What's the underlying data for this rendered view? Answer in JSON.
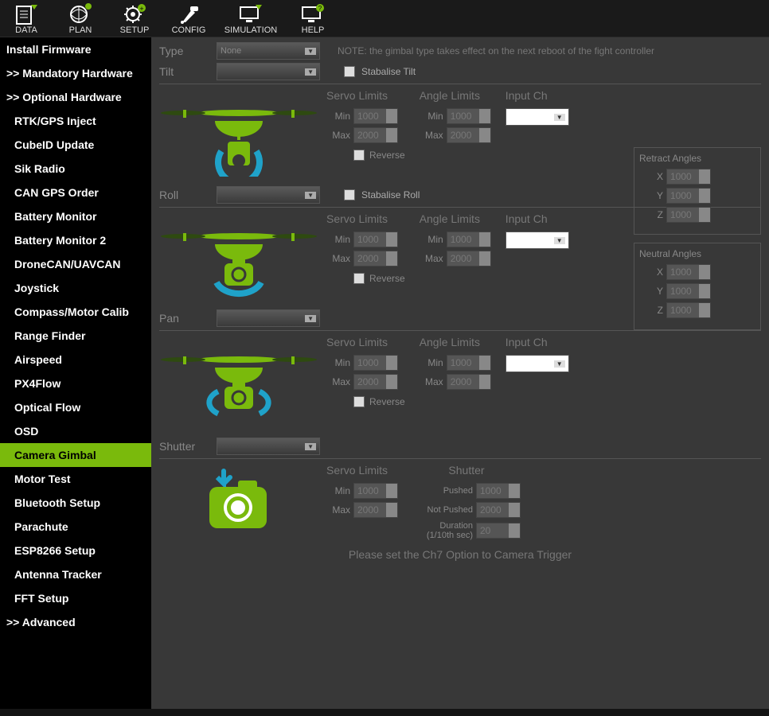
{
  "toolbar": [
    {
      "id": "data",
      "label": "DATA"
    },
    {
      "id": "plan",
      "label": "PLAN"
    },
    {
      "id": "setup",
      "label": "SETUP"
    },
    {
      "id": "config",
      "label": "CONFIG"
    },
    {
      "id": "simulation",
      "label": "SIMULATION"
    },
    {
      "id": "help",
      "label": "HELP"
    }
  ],
  "sidebar": {
    "items": [
      {
        "label": "Install Firmware",
        "sub": false
      },
      {
        "label": ">> Mandatory Hardware",
        "sub": false
      },
      {
        "label": ">> Optional Hardware",
        "sub": false
      },
      {
        "label": "RTK/GPS Inject",
        "sub": true
      },
      {
        "label": "CubeID Update",
        "sub": true
      },
      {
        "label": "Sik Radio",
        "sub": true
      },
      {
        "label": "CAN GPS Order",
        "sub": true
      },
      {
        "label": "Battery Monitor",
        "sub": true
      },
      {
        "label": "Battery Monitor 2",
        "sub": true
      },
      {
        "label": "DroneCAN/UAVCAN",
        "sub": true
      },
      {
        "label": "Joystick",
        "sub": true
      },
      {
        "label": "Compass/Motor Calib",
        "sub": true
      },
      {
        "label": "Range Finder",
        "sub": true
      },
      {
        "label": "Airspeed",
        "sub": true
      },
      {
        "label": "PX4Flow",
        "sub": true
      },
      {
        "label": "Optical Flow",
        "sub": true
      },
      {
        "label": "OSD",
        "sub": true
      },
      {
        "label": "Camera Gimbal",
        "sub": true,
        "active": true
      },
      {
        "label": "Motor Test",
        "sub": true
      },
      {
        "label": "Bluetooth Setup",
        "sub": true
      },
      {
        "label": "Parachute",
        "sub": true
      },
      {
        "label": "ESP8266 Setup",
        "sub": true
      },
      {
        "label": "Antenna Tracker",
        "sub": true
      },
      {
        "label": "FFT Setup",
        "sub": true
      },
      {
        "label": ">> Advanced",
        "sub": false
      }
    ]
  },
  "main": {
    "type_label": "Type",
    "type_value": "None",
    "note": "NOTE: the gimbal type takes effect on the next reboot of the fight controller",
    "tilt": {
      "label": "Tilt",
      "stab_label": "Stabalise Tilt",
      "servo_hdr": "Servo Limits",
      "angle_hdr": "Angle Limits",
      "input_hdr": "Input Ch",
      "min_label": "Min",
      "max_label": "Max",
      "servo_min": "1000",
      "servo_max": "2000",
      "angle_min": "1000",
      "angle_max": "2000",
      "reverse_label": "Reverse"
    },
    "roll": {
      "label": "Roll",
      "stab_label": "Stabalise Roll",
      "servo_hdr": "Servo Limits",
      "angle_hdr": "Angle Limits",
      "input_hdr": "Input Ch",
      "min_label": "Min",
      "max_label": "Max",
      "servo_min": "1000",
      "servo_max": "2000",
      "angle_min": "1000",
      "angle_max": "2000",
      "reverse_label": "Reverse"
    },
    "pan": {
      "label": "Pan",
      "servo_hdr": "Servo Limits",
      "angle_hdr": "Angle Limits",
      "input_hdr": "Input Ch",
      "min_label": "Min",
      "max_label": "Max",
      "servo_min": "1000",
      "servo_max": "2000",
      "angle_min": "1000",
      "angle_max": "2000",
      "reverse_label": "Reverse"
    },
    "shutter": {
      "label": "Shutter",
      "servo_hdr": "Servo Limits",
      "shutter_hdr": "Shutter",
      "min_label": "Min",
      "max_label": "Max",
      "servo_min": "1000",
      "servo_max": "2000",
      "pushed_label": "Pushed",
      "pushed_val": "1000",
      "notpushed_label": "Not Pushed",
      "notpushed_val": "2000",
      "duration_label": "Duration (1/10th sec)",
      "duration_val": "20"
    },
    "hint": "Please set the Ch7 Option to Camera Trigger",
    "retract": {
      "title": "Retract Angles",
      "x_label": "X",
      "x_val": "1000",
      "y_label": "Y",
      "y_val": "1000",
      "z_label": "Z",
      "z_val": "1000"
    },
    "neutral": {
      "title": "Neutral Angles",
      "x_label": "X",
      "x_val": "1000",
      "y_label": "Y",
      "y_val": "1000",
      "z_label": "Z",
      "z_val": "1000"
    }
  }
}
